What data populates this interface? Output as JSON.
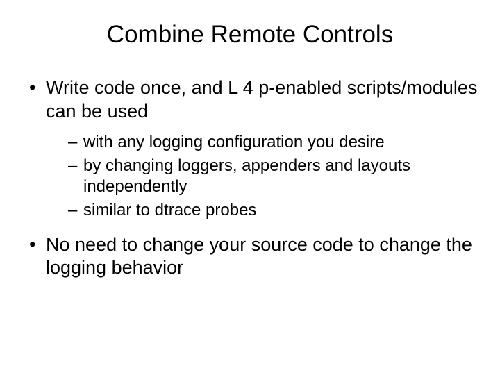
{
  "title": "Combine Remote Controls",
  "bullets": [
    {
      "text": "Write code once, and L 4 p-enabled scripts/modules can be used",
      "sub": [
        "with any logging configuration you desire",
        "by changing loggers, appenders and layouts independently",
        "similar to dtrace probes"
      ]
    },
    {
      "text": "No need to change your source code to change the logging behavior",
      "sub": []
    }
  ]
}
